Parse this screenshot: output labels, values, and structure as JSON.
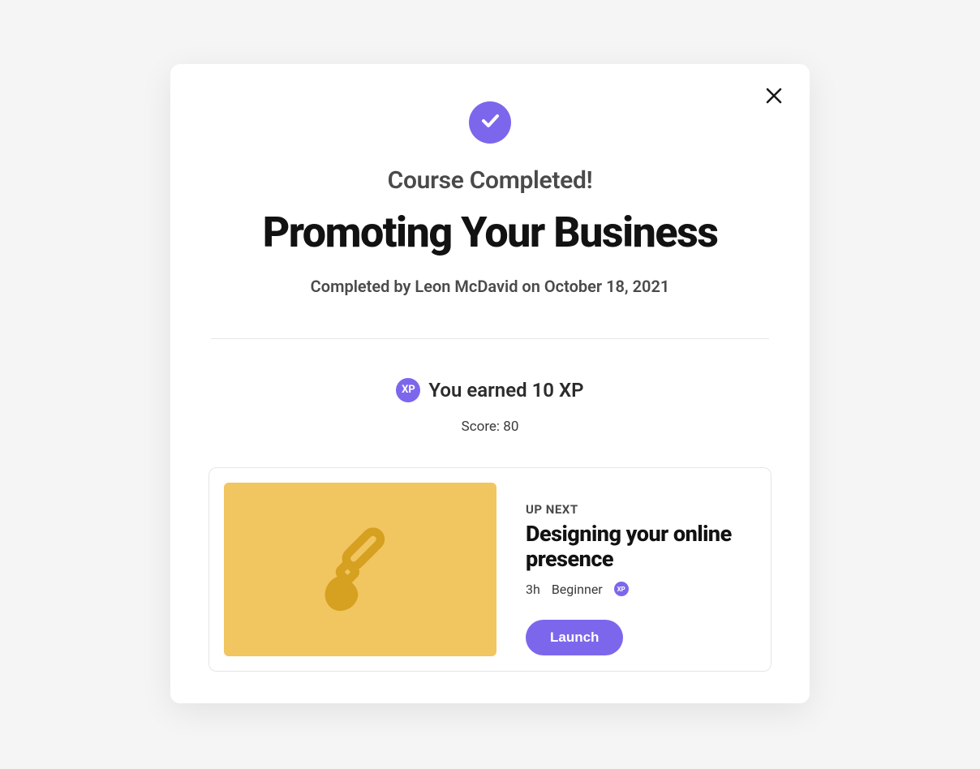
{
  "modal": {
    "status": "Course Completed!",
    "course_title": "Promoting Your Business",
    "completed_by": "Completed by Leon McDavid on October 18, 2021",
    "xp_icon_label": "XP",
    "xp_message": "You earned 10 XP",
    "score": "Score: 80",
    "up_next": {
      "label": "UP NEXT",
      "title": "Designing your online presence",
      "duration": "3h",
      "level": "Beginner",
      "xp_icon_label": "XP",
      "launch": "Launch"
    }
  },
  "colors": {
    "accent": "#7c67ec",
    "thumb_bg": "#f1c560",
    "thumb_fg": "#d6a020"
  }
}
